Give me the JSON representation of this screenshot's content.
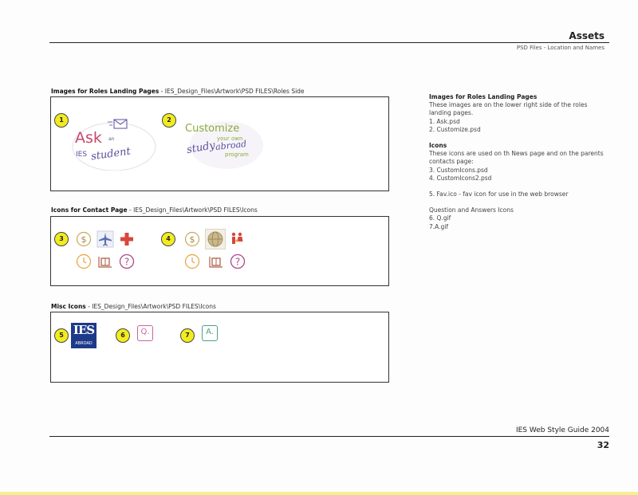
{
  "header": {
    "title": "Assets",
    "subtitle": "PSD Files - Location and Names"
  },
  "sections": {
    "roles": {
      "title": "Images for Roles Landing Pages",
      "path": " - IES_Design_Files\\Artwork\\PSD FILES\\Roles Side"
    },
    "contact": {
      "title": "Icons for Contact Page",
      "path": " - IES_Design_Files\\Artwork\\PSD FILES\\Icons"
    },
    "misc": {
      "title": "Misc Icons",
      "path": " - IES_Design_Files\\Artwork\\PSD FILES\\Icons"
    }
  },
  "markers": [
    "1",
    "2",
    "3",
    "4",
    "5",
    "6",
    "7"
  ],
  "artwork": {
    "ask_word": "Ask",
    "ask_an": "an",
    "ask_ies": "IES",
    "ask_student": "student",
    "customize_word": "Customize",
    "customize_your_own": "your own",
    "customize_study": "study",
    "customize_abroad": "abroad",
    "customize_program": "program",
    "dollar_glyph": "$",
    "question_glyph": "?",
    "ies_logo_top": "IES",
    "ies_logo_bottom": "ABROAD",
    "q_glyph": "Q.",
    "a_glyph": "A."
  },
  "sidebar": {
    "roles_heading": "Images for Roles Landing Pages",
    "roles_text": "These images are on the lower right side of the roles landing pages.",
    "roles_item1": "1. Ask.psd",
    "roles_item2": "2. Customize.psd",
    "icons_heading": "Icons",
    "icons_text": "These icons are used on th News page and on the parents contacts page:",
    "icons_item3": "3. CustomIcons.psd",
    "icons_item4": "4. CustomIcons2.psd",
    "fav_text": "5. Fav.ico - fav icon for use in the web browser",
    "qa_heading": "Question and Answers Icons",
    "qa_item6": "6. Q.gif",
    "qa_item7": "7.A.gif"
  },
  "footer": {
    "title": "IES Web Style Guide 2004",
    "page_number": "32"
  },
  "colors": {
    "marker_yellow": "#f2ec1e",
    "icon_orange": "#e8a23a",
    "icon_blue": "#5a6fb2",
    "icon_red": "#d9463a",
    "icon_purple": "#b04a8e",
    "green": "#7a9a4a",
    "teal": "#4aa08a"
  }
}
